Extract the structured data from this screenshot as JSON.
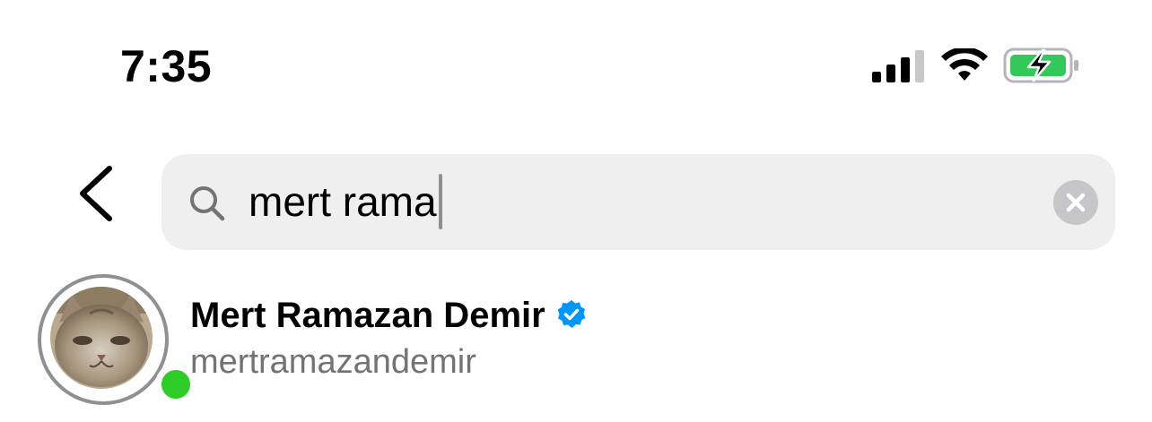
{
  "status_bar": {
    "time": "7:35",
    "icons": [
      "cellular-signal-icon",
      "wifi-icon",
      "battery-charging-icon"
    ],
    "battery_color": "#34c759"
  },
  "header": {
    "back_icon": "chevron-left-icon"
  },
  "search": {
    "value": "mert rama",
    "icon": "search-icon",
    "clear_icon": "clear-x-icon"
  },
  "results": [
    {
      "display_name": "Mert Ramazan Demir",
      "username": "mertramazandemir",
      "verified": true,
      "online": true,
      "badge_color": "#0095f6",
      "online_color": "#2ecc27"
    }
  ]
}
